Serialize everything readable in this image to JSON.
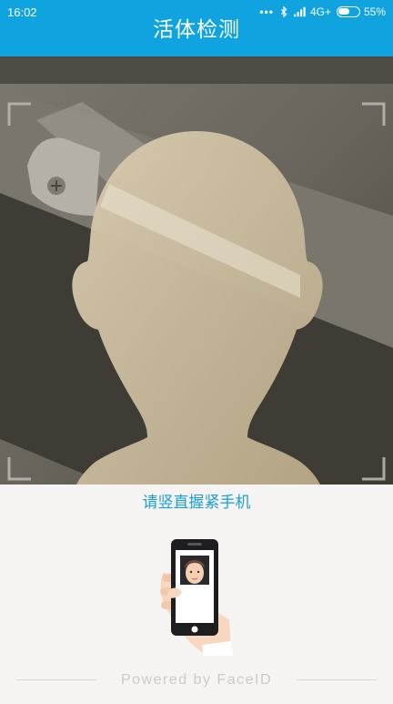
{
  "status_bar": {
    "time": "16:02",
    "network": "4G+",
    "battery": "55%"
  },
  "header": {
    "title": "活体检测"
  },
  "camera": {
    "overlay_icon": "face-silhouette-icon",
    "corner_icons": "viewfinder-corner-icon"
  },
  "main": {
    "prompt": "请竖直握紧手机",
    "illustration": "hand-holding-phone-icon"
  },
  "footer": {
    "powered_by": "Powered  by  FaceID"
  },
  "colors": {
    "accent": "#0fa3e0",
    "prompt": "#1a9fd8",
    "background": "#f5f4f2"
  }
}
